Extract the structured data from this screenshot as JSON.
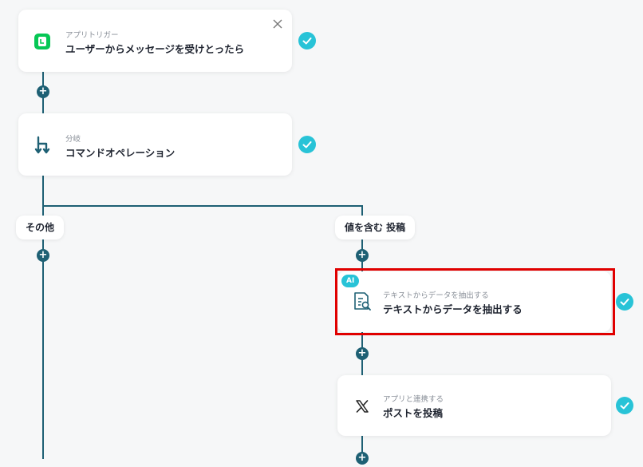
{
  "nodes": [
    {
      "subtitle": "アプリトリガー",
      "title": "ユーザーからメッセージを受けとったら",
      "icon": "line-app-icon"
    },
    {
      "subtitle": "分岐",
      "title": "コマンドオペレーション",
      "icon": "branch-icon"
    },
    {
      "subtitle": "テキストからデータを抽出する",
      "title": "テキストからデータを抽出する",
      "icon": "document-search-icon",
      "badge": "AI"
    },
    {
      "subtitle": "アプリと連携する",
      "title": "ポストを投稿",
      "icon": "x-logo-icon"
    }
  ],
  "branches": {
    "left": "その他",
    "right": "値を含む 投稿"
  },
  "plus_symbol": "+",
  "colors": {
    "connector": "#1e6074",
    "check": "#28c3d7",
    "highlight": "#e00000",
    "line_green": "#06c755"
  }
}
